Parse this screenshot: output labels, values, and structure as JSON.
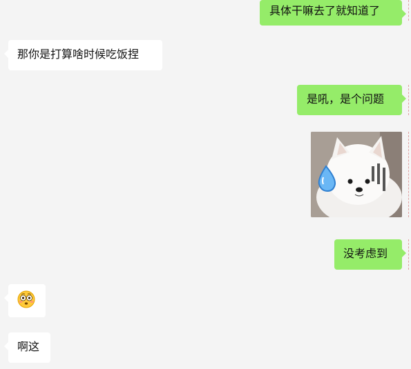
{
  "messages": [
    {
      "direction": "outgoing",
      "type": "text",
      "text": "具体干嘛去了就知道了"
    },
    {
      "direction": "incoming",
      "type": "text",
      "text": "那你是打算啥时候吃饭捏"
    },
    {
      "direction": "outgoing",
      "type": "text",
      "text": "是吼，是个问题"
    },
    {
      "direction": "outgoing",
      "type": "sticker",
      "sticker_name": "samoyed-dog-sweat-sticker"
    },
    {
      "direction": "outgoing",
      "type": "text",
      "text": "没考虑到"
    },
    {
      "direction": "incoming",
      "type": "emoji",
      "emoji_name": "flushed-face-emoji"
    },
    {
      "direction": "incoming",
      "type": "text",
      "text": "啊这"
    }
  ],
  "colors": {
    "background": "#f4f4f4",
    "outgoing_bubble": "#95ec69",
    "incoming_bubble": "#ffffff",
    "text": "#111111"
  }
}
